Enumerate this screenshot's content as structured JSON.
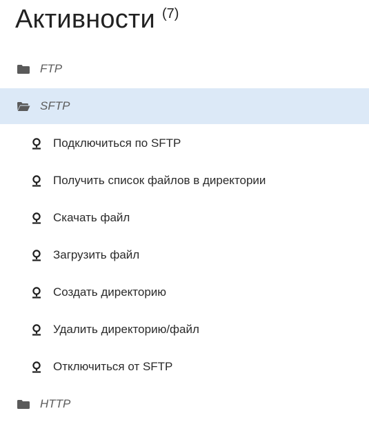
{
  "header": {
    "title": "Активности",
    "count": "(7)"
  },
  "tree": {
    "folders": [
      {
        "label": "FTP",
        "icon": "folder-closed-icon"
      },
      {
        "label": "SFTP",
        "icon": "folder-open-icon",
        "selected": true
      },
      {
        "label": "HTTP",
        "icon": "folder-closed-icon"
      }
    ],
    "activities": [
      {
        "label": "Подключиться по SFTP",
        "icon": "activity-icon"
      },
      {
        "label": "Получить список файлов в директории",
        "icon": "activity-icon"
      },
      {
        "label": "Скачать файл",
        "icon": "activity-icon"
      },
      {
        "label": "Загрузить файл",
        "icon": "activity-icon"
      },
      {
        "label": "Создать директорию",
        "icon": "activity-icon"
      },
      {
        "label": "Удалить директорию/файл",
        "icon": "activity-icon"
      },
      {
        "label": "Отключиться от SFTP",
        "icon": "activity-icon"
      }
    ]
  },
  "colors": {
    "selected_background": "#dce9f7",
    "icon_gray": "#5a5a5a",
    "activity_icon": "#1f1f1f"
  }
}
